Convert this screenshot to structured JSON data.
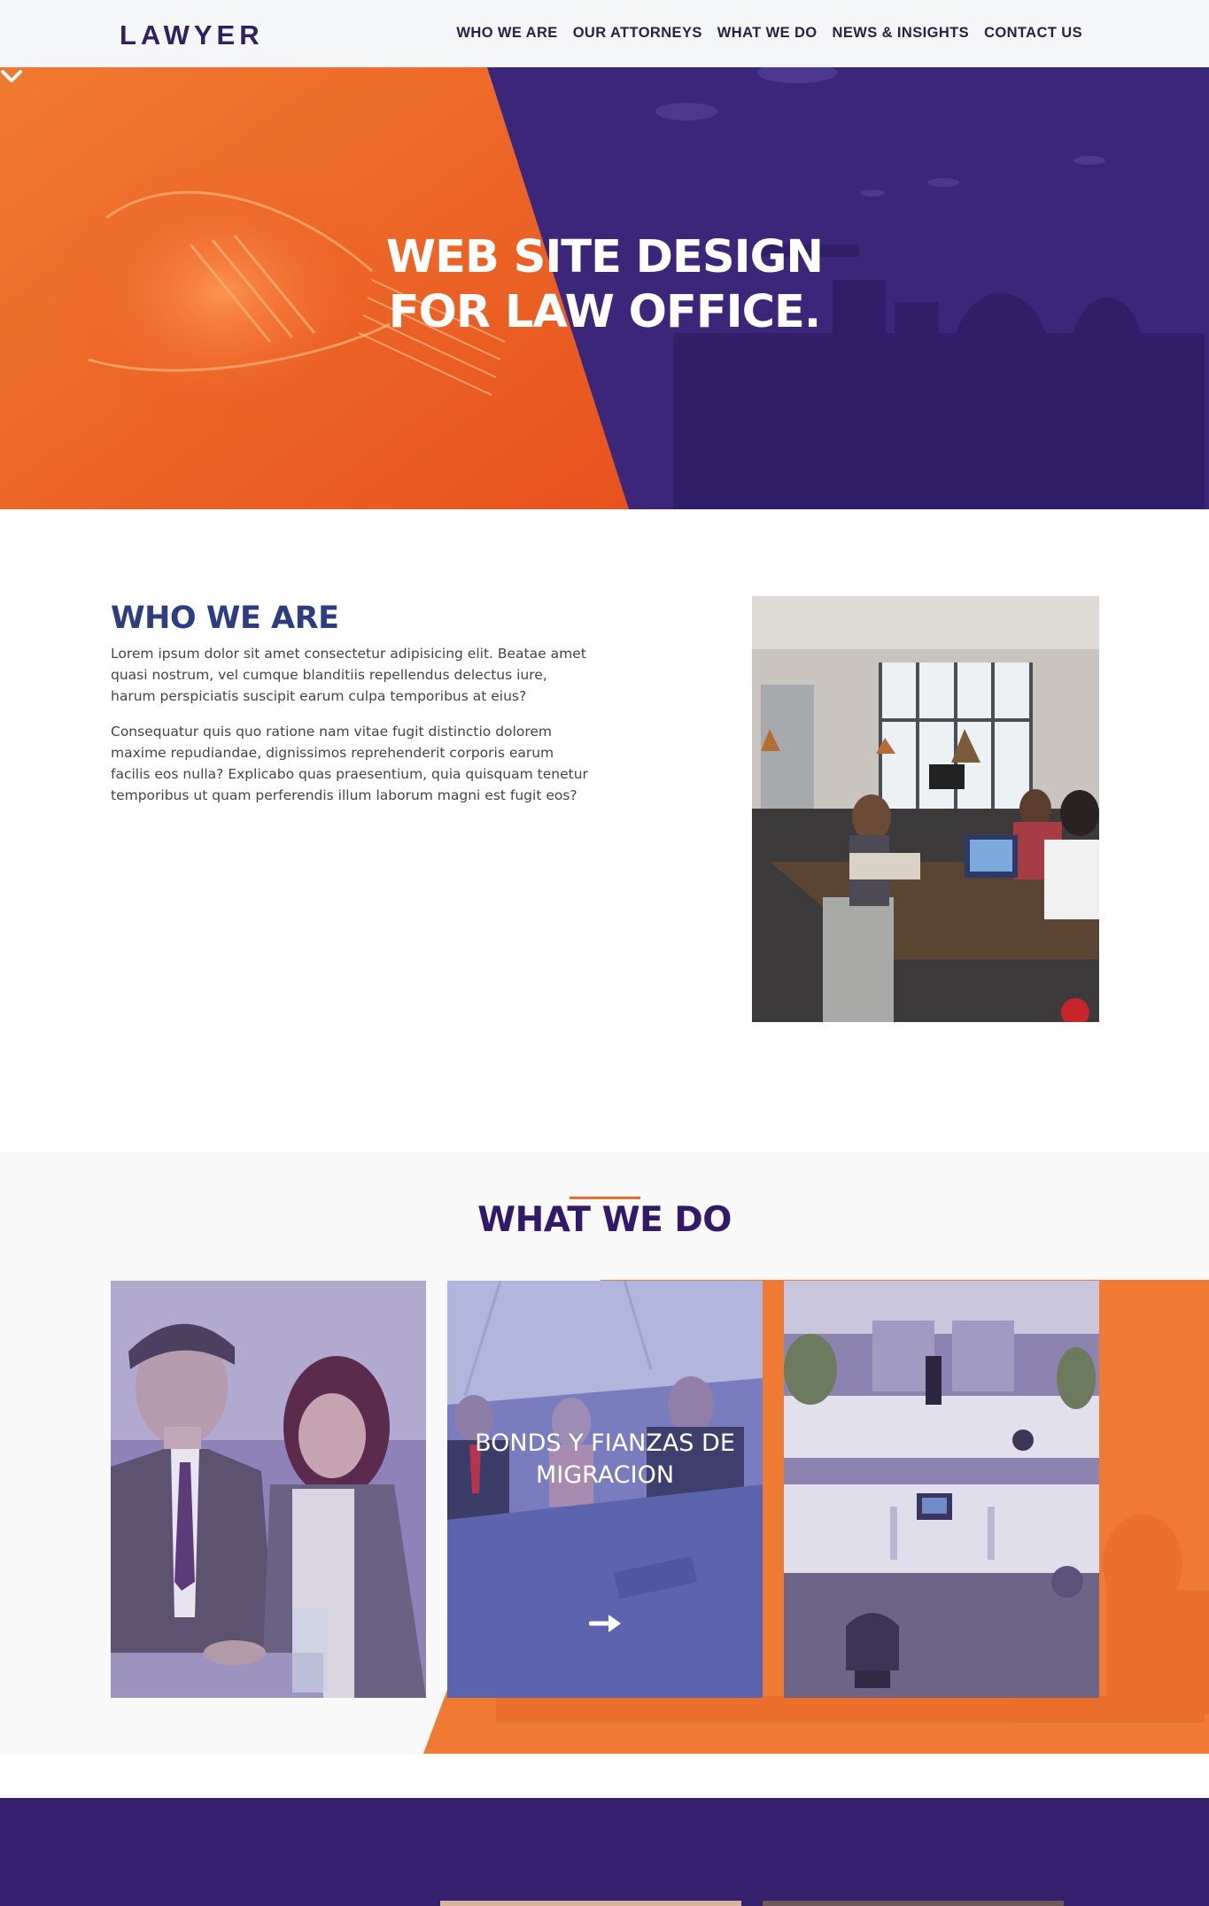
{
  "brand": {
    "logo": "LAWYER"
  },
  "nav": {
    "items": [
      "WHO WE ARE",
      "OUR ATTORNEYS",
      "WHAT WE DO",
      "NEWS & INSIGHTS",
      "CONTACT US"
    ]
  },
  "hero": {
    "title_line1": "WEB SITE DESIGN",
    "title_line2": "FOR LAW OFFICE.",
    "scroll_icon": "chevron-down-icon"
  },
  "who": {
    "title": "WHO WE ARE",
    "p1": "Lorem ipsum dolor sit amet consectetur adipisicing elit. Beatae amet quasi nostrum, vel cumque blanditiis repellendus delectus iure, harum perspiciatis suscipit earum culpa temporibus at eius?",
    "p2": "Consequatur quis quo ratione nam vitae fugit distinctio dolorem maxime repudiandae, dignissimos reprehenderit corporis earum facilis eos nulla? Explicabo quas praesentium, quia quisquam tenetur temporibus ut quam perferendis illum laborum magni est fugit eos?"
  },
  "what": {
    "title": "WHAT WE DO",
    "cards": [
      {
        "label": ""
      },
      {
        "label": "BONDS Y FIANZAS DE MIGRACION",
        "icon": "arrow-right-icon"
      },
      {
        "label": ""
      }
    ]
  },
  "colors": {
    "brand_purple": "#37216f",
    "accent_orange": "#ef6a2a",
    "heading_blue": "#2e3d7f",
    "card_overlay_blue": "#4d5aa8"
  }
}
